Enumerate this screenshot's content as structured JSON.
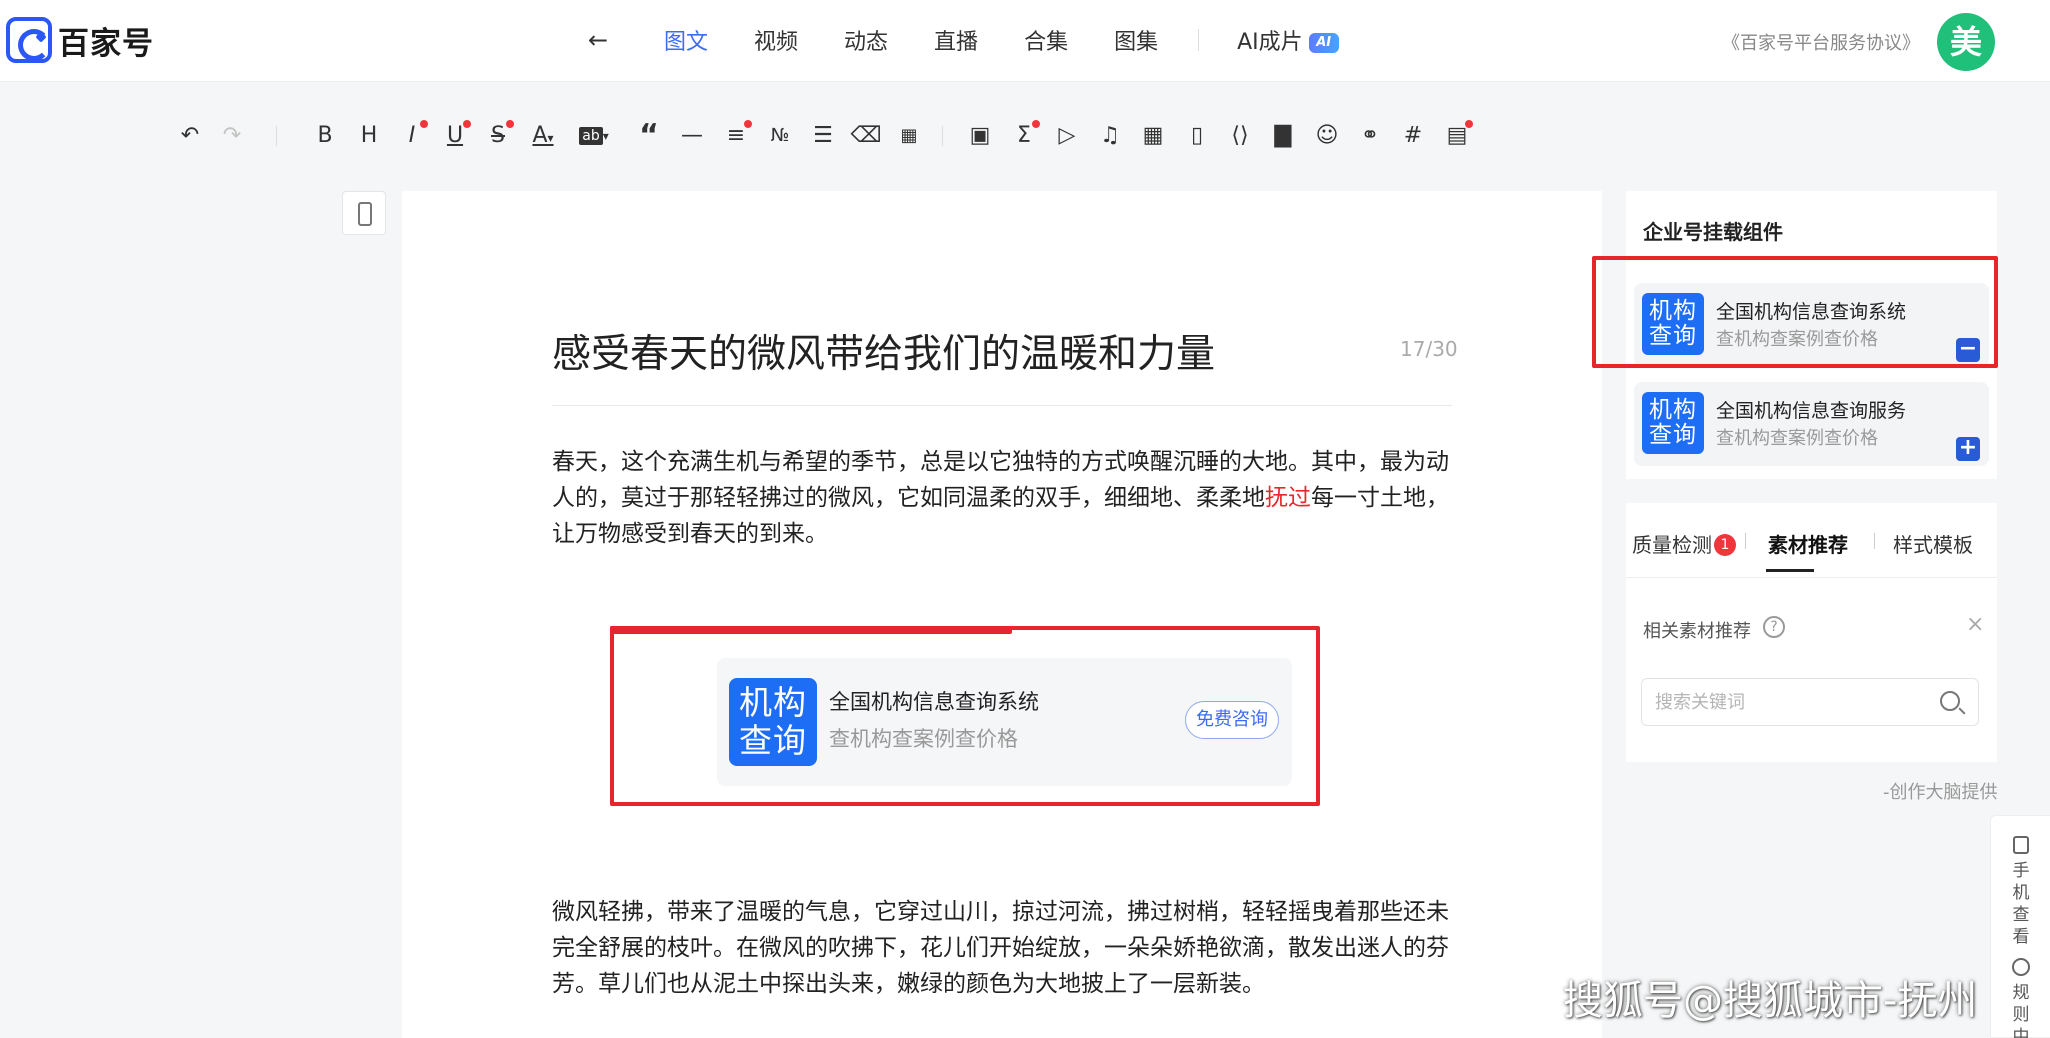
{
  "brand": {
    "name": "百家号"
  },
  "nav": {
    "items": [
      "图文",
      "视频",
      "动态",
      "直播",
      "合集",
      "图集"
    ],
    "active_index": 0,
    "ai_label": "AI成片",
    "ai_badge": "AI"
  },
  "header": {
    "agreement": "《百家号平台服务协议》",
    "avatar": "美"
  },
  "toolbar": {
    "icons": [
      "undo-icon",
      "redo-icon",
      "bold-icon",
      "heading-icon",
      "italic-icon",
      "underline-icon",
      "strikethrough-icon",
      "font-color-icon",
      "highlight-icon",
      "quote-icon",
      "divider-icon",
      "align-icon",
      "ordered-list-icon",
      "unordered-list-icon",
      "eraser-icon",
      "format-icon",
      "image-icon",
      "formula-icon",
      "video-icon",
      "music-icon",
      "table-icon",
      "bookmark-icon",
      "code-icon",
      "chart-icon",
      "user-icon",
      "link-icon",
      "hashtag-icon",
      "document-icon"
    ]
  },
  "article": {
    "title": "感受春天的微风带给我们的温暖和力量",
    "title_counter": "17/30",
    "paragraph1_a": "春天，这个充满生机与希望的季节，总是以它独特的方式唤醒沉睡的大地。其中，最为动人的，莫过于那轻轻拂过的微风，它如同温柔的双手，细细地、柔柔地",
    "paragraph1_highlight": "抚过",
    "paragraph1_b": "每一寸土地，让万物感受到春天的到来。",
    "paragraph2": "微风轻拂，带来了温暖的气息，它穿过山川，掠过河流，拂过树梢，轻轻摇曳着那些还未完全舒展的枝叶。在微风的吹拂下，花儿们开始绽放，一朵朵娇艳欲滴，散发出迷人的芬芳。草儿们也从泥土中探出头来，嫩绿的颜色为大地披上了一层新装。"
  },
  "embed_card": {
    "icon_text_line1": "机构",
    "icon_text_line2": "查询",
    "name": "全国机构信息查询系统",
    "desc": "查机构查案例查价格",
    "button": "免费咨询"
  },
  "widget_panel": {
    "title": "企业号挂载组件",
    "items": [
      {
        "icon_line1": "机构",
        "icon_line2": "查询",
        "name": "全国机构信息查询系统",
        "desc": "查机构查案例查价格",
        "action": "−"
      },
      {
        "icon_line1": "机构",
        "icon_line2": "查询",
        "name": "全国机构信息查询服务",
        "desc": "查机构查案例查价格",
        "action": "+"
      }
    ]
  },
  "assist_panel": {
    "tabs": [
      "质量检测",
      "素材推荐",
      "样式模板"
    ],
    "active_tab": 1,
    "quality_badge": "1",
    "related_label": "相关素材推荐",
    "help": "?",
    "close": "×",
    "search_placeholder": "搜索关键词",
    "provided_by": "-创作大脑提供"
  },
  "side_float": {
    "phone_preview": "手机查看",
    "rules": "规则中心"
  },
  "watermark": "搜狐号@搜狐城市-抚州",
  "colors": {
    "accent": "#3b6cf6",
    "highlight_red": "#e8262d",
    "annotation_red": "#e7262b",
    "org_icon_blue": "#1e6ef5"
  }
}
